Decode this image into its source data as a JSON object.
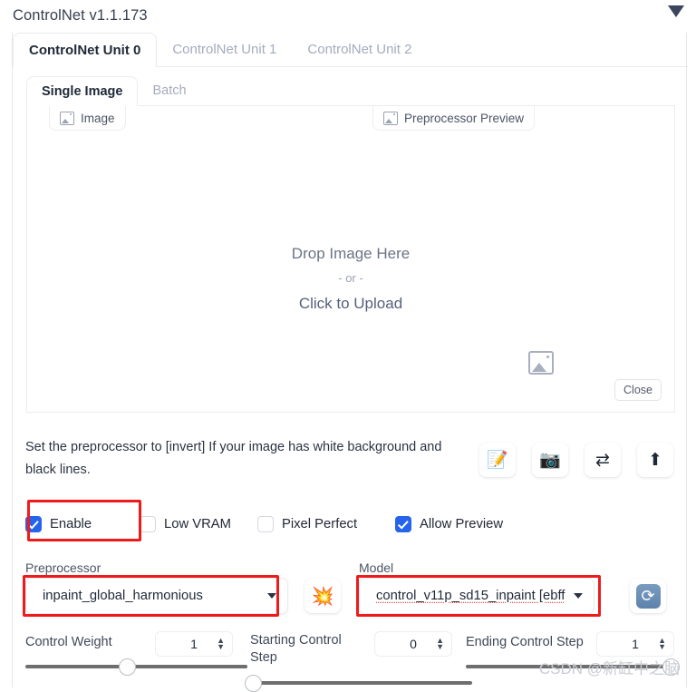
{
  "header": {
    "title": "ControlNet v1.1.173",
    "collapse_icon": "caret-down-icon"
  },
  "tabs": [
    {
      "label": "ControlNet Unit 0",
      "active": true
    },
    {
      "label": "ControlNet Unit 1",
      "active": false
    },
    {
      "label": "ControlNet Unit 2",
      "active": false
    }
  ],
  "inner_tabs": [
    {
      "label": "Single Image",
      "active": true
    },
    {
      "label": "Batch",
      "active": false
    }
  ],
  "image_panel": {
    "image_chip": "Image",
    "preview_chip": "Preprocessor Preview",
    "drop_main": "Drop Image Here",
    "drop_or": "- or -",
    "drop_click": "Click to Upload",
    "close_label": "Close",
    "chip_icon": "image-placeholder-icon",
    "preview_placeholder_icon": "image-placeholder-icon"
  },
  "hint": "Set the preprocessor to [invert] If your image has white background and black lines.",
  "tools": [
    {
      "name": "edit-memo-icon",
      "glyph": "📝"
    },
    {
      "name": "camera-icon",
      "glyph": "📷"
    },
    {
      "name": "swap-arrows-icon",
      "glyph": "⇄"
    },
    {
      "name": "send-up-icon",
      "glyph": "⬆"
    }
  ],
  "checkboxes": [
    {
      "label": "Enable",
      "checked": true
    },
    {
      "label": "Low VRAM",
      "checked": false
    },
    {
      "label": "Pixel Perfect",
      "checked": false
    },
    {
      "label": "Allow Preview",
      "checked": true
    }
  ],
  "preprocessor": {
    "label": "Preprocessor",
    "value": "inpaint_global_harmonious",
    "caret_icon": "chevron-down-icon"
  },
  "model": {
    "label": "Model",
    "value": "control_v11p_sd15_inpaint [ebff",
    "caret_icon": "chevron-down-icon"
  },
  "run_button": {
    "name": "explosion-icon",
    "glyph": "💥"
  },
  "refresh_button": {
    "name": "refresh-models-icon",
    "glyph": "⟳"
  },
  "sliders": [
    {
      "label": "Control Weight",
      "value": "1",
      "fill": 0.5
    },
    {
      "label": "Starting Control Step",
      "value": "0",
      "fill": 0.0
    },
    {
      "label": "Ending Control Step",
      "value": "1",
      "fill": 1.0
    }
  ],
  "colors": {
    "accent_blue": "#2563eb",
    "highlight_red": "#ee1b1b",
    "text_dark": "#1f2937",
    "text_muted": "#a5abbd",
    "slider_track": "#6e6e6e"
  },
  "watermark": "CSDN @新缸中之脑"
}
